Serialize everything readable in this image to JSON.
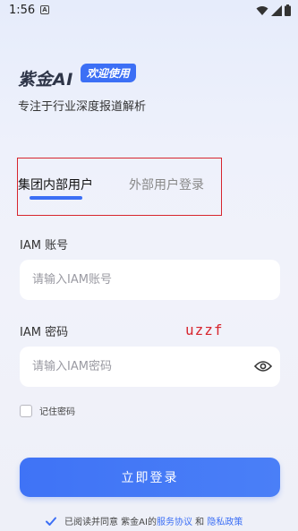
{
  "status_bar": {
    "time": "1:56",
    "notif_letter": "A"
  },
  "header": {
    "logo": "紫金AI",
    "welcome": "欢迎使用",
    "subtitle": "专注于行业深度报道解析"
  },
  "tabs": {
    "internal": "集团内部用户",
    "external": "外部用户登录"
  },
  "form": {
    "account_label": "IAM 账号",
    "account_placeholder": "请输入IAM账号",
    "password_label": "IAM 密码",
    "password_placeholder": "请输入IAM密码",
    "annotation": "uzzf",
    "remember_label": "记住密码",
    "remember_checked": false
  },
  "login_button": "立即登录",
  "agreement": {
    "prefix": "已阅读并同意 紫金AI的",
    "service": "服务协议",
    "and": " 和 ",
    "privacy": "隐私政策",
    "checked": true
  },
  "colors": {
    "accent": "#3c6ff5",
    "annotation": "#d7262e"
  }
}
